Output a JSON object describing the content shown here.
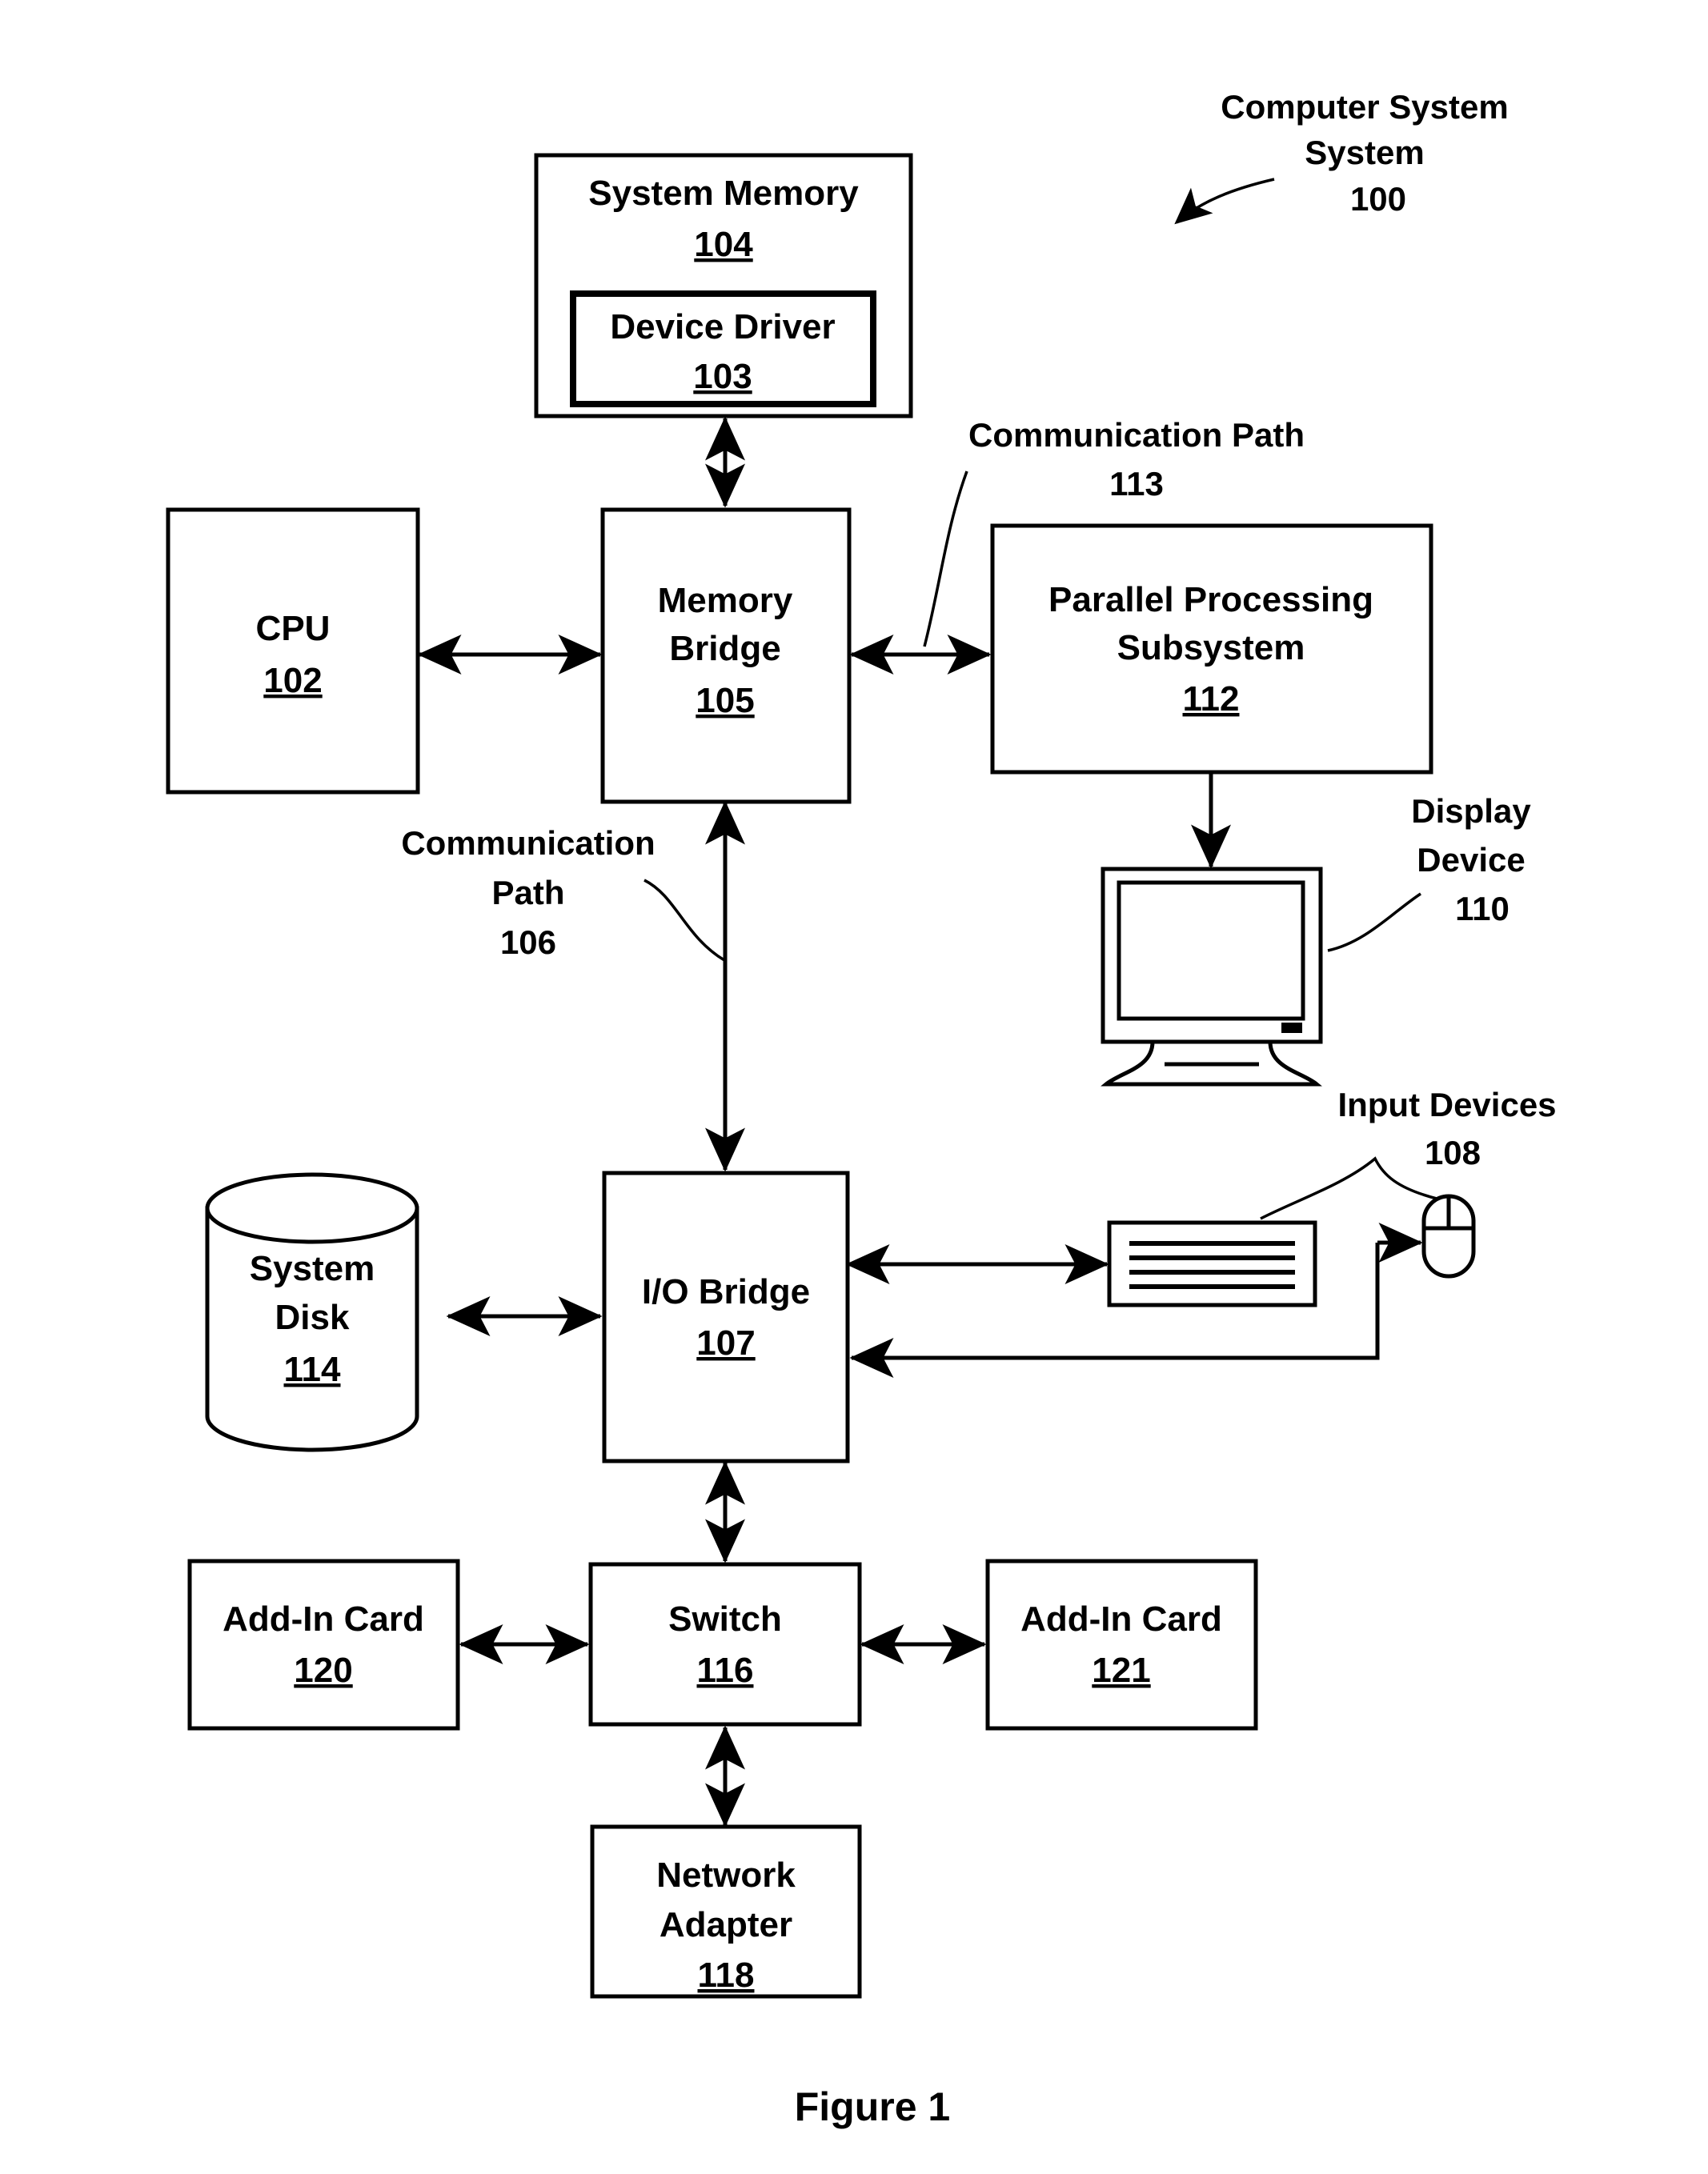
{
  "figure": {
    "caption": "Figure 1",
    "title_label": "Computer System",
    "title_number": "100"
  },
  "blocks": {
    "system_memory": {
      "label": "System Memory",
      "number": "104"
    },
    "device_driver": {
      "label": "Device Driver",
      "number": "103"
    },
    "cpu": {
      "label": "CPU",
      "number": "102"
    },
    "memory_bridge": {
      "label_line1": "Memory",
      "label_line2": "Bridge",
      "number": "105"
    },
    "parallel_processing": {
      "label_line1": "Parallel Processing",
      "label_line2": "Subsystem",
      "number": "112"
    },
    "display_device": {
      "label_line1": "Display",
      "label_line2": "Device",
      "number": "110"
    },
    "input_devices": {
      "label": "Input Devices",
      "number": "108"
    },
    "system_disk": {
      "label_line1": "System",
      "label_line2": "Disk",
      "number": "114"
    },
    "io_bridge": {
      "label": "I/O Bridge",
      "number": "107"
    },
    "add_in_card_120": {
      "label": "Add-In Card",
      "number": "120"
    },
    "switch": {
      "label": "Switch",
      "number": "116"
    },
    "add_in_card_121": {
      "label": "Add-In Card",
      "number": "121"
    },
    "network_adapter": {
      "label_line1": "Network",
      "label_line2": "Adapter",
      "number": "118"
    }
  },
  "annotations": {
    "comm_path_113": {
      "label_line1": "Communication Path",
      "number": "113"
    },
    "comm_path_106": {
      "label_line1": "Communication",
      "label_line2": "Path",
      "number": "106"
    }
  },
  "colors": {
    "ink": "#000000",
    "paper": "#ffffff"
  }
}
